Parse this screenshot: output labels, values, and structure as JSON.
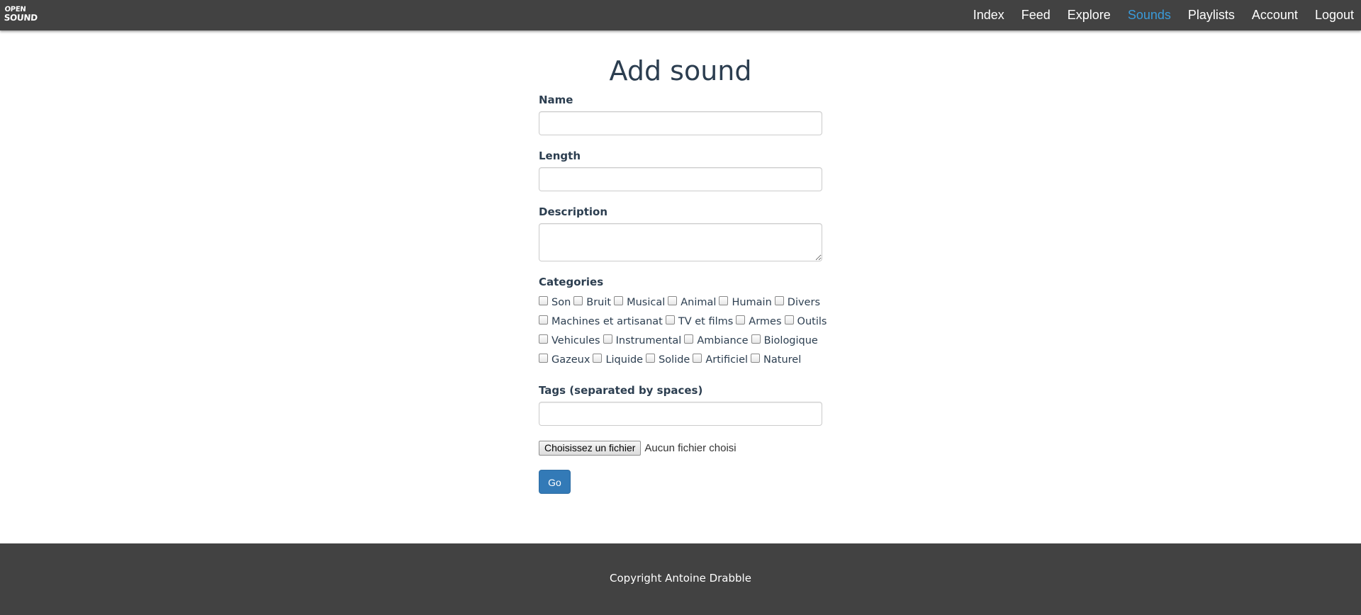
{
  "brand": {
    "logo_line1": "OPEN",
    "logo_line2": "SOUND"
  },
  "nav": {
    "items": [
      {
        "label": "Index"
      },
      {
        "label": "Feed"
      },
      {
        "label": "Explore"
      },
      {
        "label": "Sounds",
        "active": true
      },
      {
        "label": "Playlists"
      },
      {
        "label": "Account"
      },
      {
        "label": "Logout"
      }
    ],
    "active_color": "#3a9ad9"
  },
  "form": {
    "title": "Add sound",
    "name_label": "Name",
    "name_value": "",
    "length_label": "Length",
    "length_value": "",
    "description_label": "Description",
    "description_value": "",
    "categories_label": "Categories",
    "categories": {
      "row1": [
        "Son",
        "Bruit",
        "Musical",
        "Animal",
        "Humain",
        "Divers"
      ],
      "row2": [
        "Machines et artisanat",
        "TV et films",
        "Armes",
        "Outils"
      ],
      "row3": [
        "Vehicules",
        "Instrumental",
        "Ambiance",
        "Biologique"
      ],
      "row4": [
        "Gazeux",
        "Liquide",
        "Solide",
        "Artificiel",
        "Naturel"
      ]
    },
    "tags_label": "Tags (separated by spaces)",
    "tags_value": "",
    "file_button_label": "Choisissez un fichier",
    "file_status": "Aucun fichier choisi",
    "submit_label": "Go"
  },
  "footer": {
    "text": "Copyright Antoine Drabble"
  },
  "colors": {
    "navbar_bg": "#424242",
    "primary_button": "#337ab7",
    "text": "#2c3e50"
  }
}
